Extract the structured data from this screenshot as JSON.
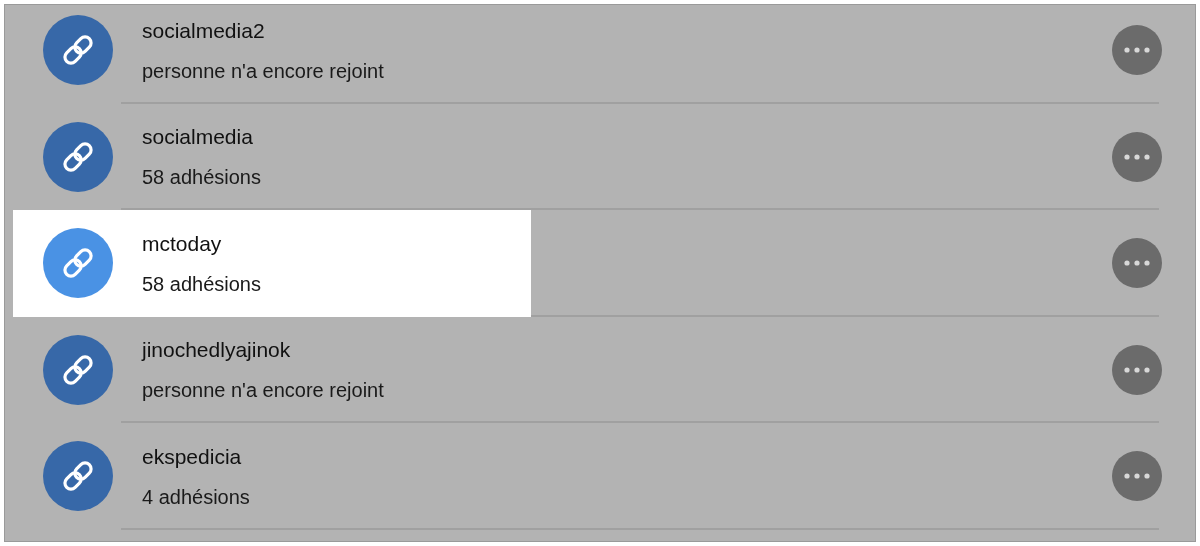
{
  "links": [
    {
      "name": "socialmedia2",
      "members": "personne n'a encore rejoint",
      "highlighted": false
    },
    {
      "name": "socialmedia",
      "members": "58 adhésions",
      "highlighted": false
    },
    {
      "name": "mctoday",
      "members": "58 adhésions",
      "highlighted": true
    },
    {
      "name": "jinochedlyajinok",
      "members": "personne n'a encore rejoint",
      "highlighted": false
    },
    {
      "name": "ekspedicia",
      "members": "4 adhésions",
      "highlighted": false
    }
  ]
}
